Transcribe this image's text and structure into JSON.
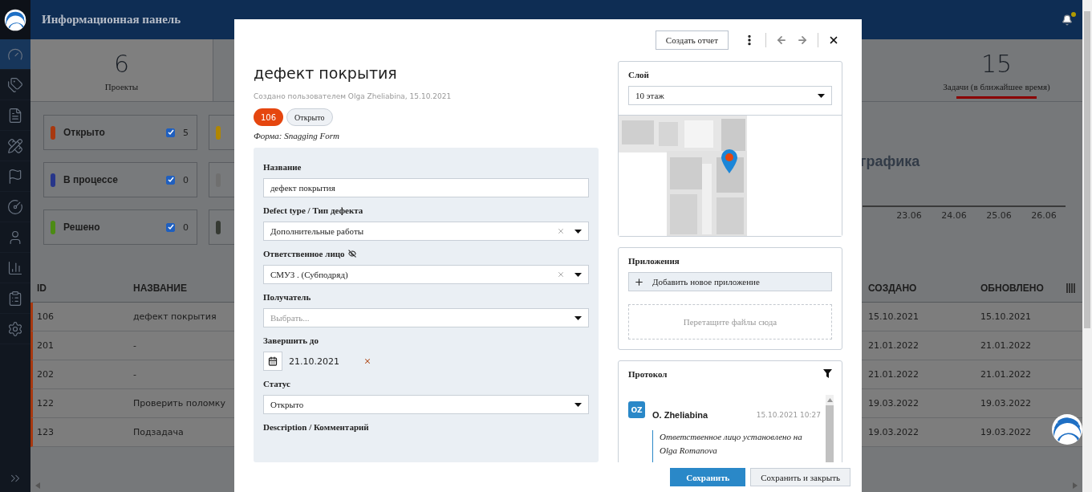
{
  "header": {
    "title": "Информационная панель"
  },
  "sidebar": {
    "items": [
      {
        "selected": true
      },
      {
        "selected": false
      },
      {
        "selected": false
      },
      {
        "selected": false
      },
      {
        "selected": false
      },
      {
        "selected": false
      },
      {
        "selected": false
      },
      {
        "selected": false
      },
      {
        "selected": false
      },
      {
        "selected": false
      }
    ]
  },
  "stats": [
    {
      "value": "6",
      "label": "Проекты",
      "active": true,
      "selected": false
    },
    {
      "value": "15",
      "label": "Задачи (в ближайшее время)",
      "active": false,
      "selected": true
    }
  ],
  "status_cards": [
    {
      "label": "Открыто",
      "color": "#a8380f",
      "checked": true,
      "count": "5"
    },
    {
      "color": "#b08600"
    },
    {
      "label": "В процессе",
      "color": "#27368a",
      "checked": true,
      "count": "0"
    },
    {
      "color": "#6f6f6f"
    },
    {
      "label": "Решено",
      "color": "#4c8b14",
      "checked": true,
      "count": "0"
    },
    {
      "color": "#363a33"
    }
  ],
  "chart_axis": {
    "title": "графика",
    "ticks": [
      "23.06",
      "24.06",
      "25.06",
      "26.06"
    ]
  },
  "table": {
    "columns": [
      "ID",
      "НАЗВАНИЕ",
      "СОЗДАНО",
      "ОБНОВЛЕНО"
    ],
    "rows": [
      {
        "id": "106",
        "name": "дефект покрытия",
        "created": "15.10.2021",
        "updated": "15.10.2021"
      },
      {
        "id": "201",
        "name": "-",
        "created": "21.01.2022",
        "updated": "21.01.2022"
      },
      {
        "id": "202",
        "name": "-",
        "created": "21.01.2022",
        "updated": "21.01.2022"
      },
      {
        "id": "122",
        "name": "Проверить поломку",
        "created": "19.03.2022",
        "updated": "19.03.2022"
      },
      {
        "id": "123",
        "name": "Подзадача",
        "created": "19.03.2022",
        "updated": "19.03.2022"
      }
    ]
  },
  "modal": {
    "report_button": "Создать отчет",
    "title": "дефект покрытия",
    "meta": "Создано пользователем Olga Zheliabina, 15.10.2021",
    "badges": [
      {
        "text": "106",
        "kind": "id"
      },
      {
        "text": "Открыто",
        "kind": "status"
      }
    ],
    "form_name": "Форма: Snagging Form",
    "fields": [
      {
        "label": "Название",
        "kind": "text",
        "value": "дефект покрытия"
      },
      {
        "label": "Defect type / Тип дефекта",
        "kind": "select",
        "value": "Дополнительные работы",
        "clearable": true
      },
      {
        "label": "Ответственное лицо",
        "kind": "select",
        "value": "СМУЗ . (Субподряд)",
        "clearable": true,
        "private": true
      },
      {
        "label": "Получатель",
        "kind": "select",
        "placeholder": "Выбрать..."
      },
      {
        "label": "Завершить до",
        "kind": "date",
        "value": "21.10.2021",
        "clearable": true
      },
      {
        "label": "Статус",
        "kind": "select",
        "value": "Открыто"
      },
      {
        "label": "Description / Комментарий",
        "kind": "textarea"
      }
    ],
    "layer": {
      "label": "Слой",
      "value": "10 этаж"
    },
    "attachments": {
      "label": "Приложения",
      "add_button": "Добавить новое приложение",
      "dropzone": "Перетащите файлы сюда"
    },
    "protocol": {
      "label": "Протокол",
      "entries": [
        {
          "initials": "OZ",
          "author": "O. Zheliabina",
          "time": "15.10.2021 10:27",
          "text": "Ответственное лицо установлено на Olga Romanova"
        }
      ]
    },
    "buttons": [
      {
        "label": "Сохранить",
        "kind": "primary"
      },
      {
        "label": "Сохранить и закрыть",
        "kind": "secondary"
      }
    ]
  }
}
